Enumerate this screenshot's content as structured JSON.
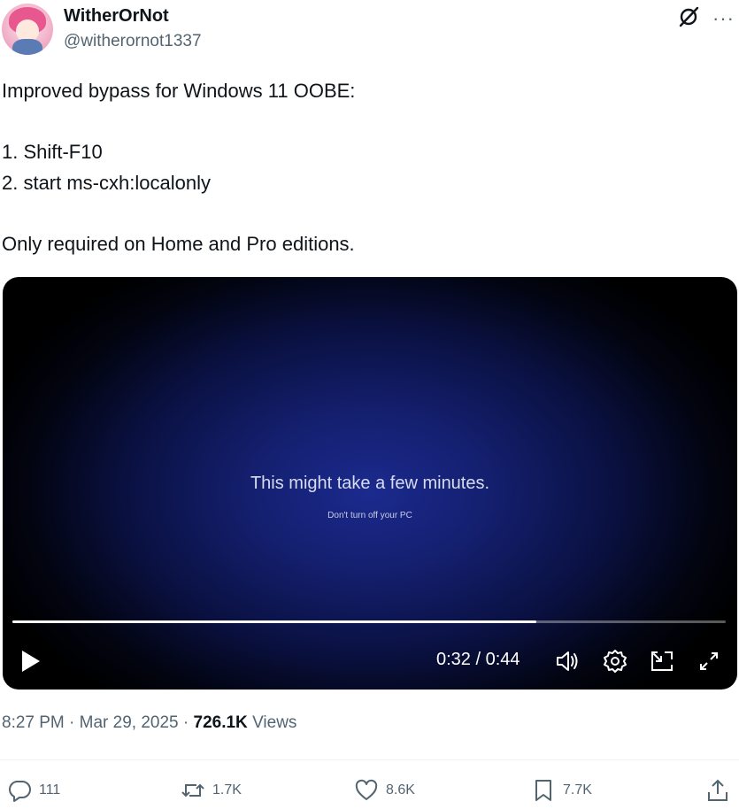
{
  "author": {
    "name": "WitherOrNot",
    "handle": "@witherornot1337"
  },
  "tweet": {
    "text": "Improved bypass for Windows 11 OOBE:\n\n1. Shift-F10\n2. start ms-cxh:localonly\n\nOnly required on Home and Pro editions."
  },
  "video": {
    "main_text": "This might take a few minutes.",
    "sub_text": "Don't turn off your PC",
    "time_display": "0:32 / 0:44",
    "progress": 0.735
  },
  "meta": {
    "time": "8:27 PM",
    "date": "Mar 29, 2025",
    "views_count": "726.1K",
    "views_label": "Views"
  },
  "actions": {
    "replies": "111",
    "reposts": "1.7K",
    "likes": "8.6K",
    "bookmarks": "7.7K"
  },
  "icons": [
    "grok-icon",
    "more-icon",
    "play-icon",
    "volume-icon",
    "settings-icon",
    "pip-icon",
    "fullscreen-icon",
    "reply-icon",
    "repost-icon",
    "like-icon",
    "bookmark-icon",
    "share-icon"
  ]
}
